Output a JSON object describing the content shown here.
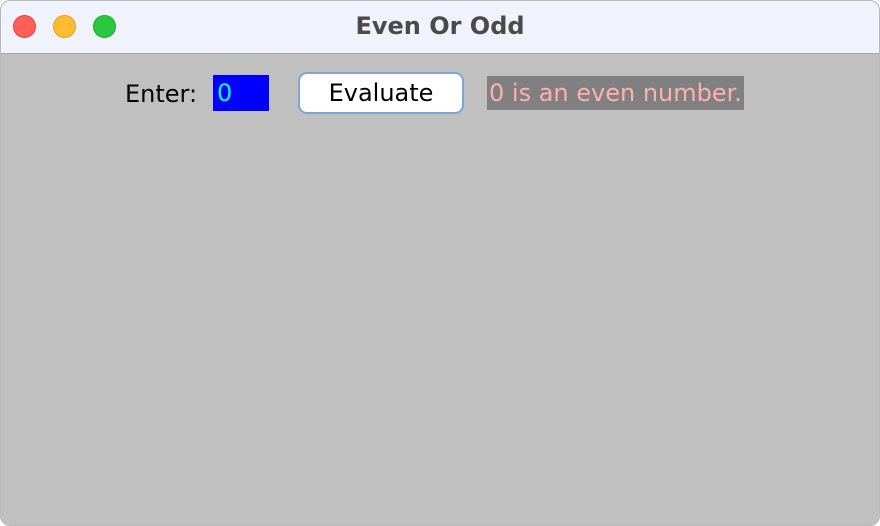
{
  "window": {
    "title": "Even Or Odd"
  },
  "form": {
    "enter_label": "Enter:",
    "number_value": "0",
    "evaluate_label": "Evaluate",
    "result": "0 is an even number."
  },
  "colors": {
    "content_background": "#c0c0c0",
    "input_background": "#0000ff",
    "input_text": "#00ffff",
    "result_background": "#808080",
    "result_text": "#ffafaf"
  },
  "icons": [
    "close-window-icon",
    "minimize-window-icon",
    "zoom-window-icon"
  ]
}
